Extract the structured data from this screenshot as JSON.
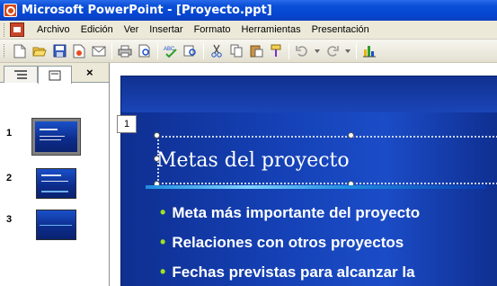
{
  "window": {
    "title": "Microsoft PowerPoint - [Proyecto.ppt]",
    "title_bar_color": "#0a4ed6"
  },
  "menu": {
    "items": [
      "Archivo",
      "Edición",
      "Ver",
      "Insertar",
      "Formato",
      "Herramientas",
      "Presentación"
    ]
  },
  "toolbar": {
    "buttons": [
      "new-icon",
      "open-icon",
      "save-icon",
      "permission-icon",
      "email-icon",
      "print-icon",
      "print-preview-icon",
      "spelling-icon",
      "research-icon",
      "cut-icon",
      "copy-icon",
      "paste-icon",
      "format-painter-icon",
      "undo-icon",
      "redo-icon",
      "chart-icon"
    ],
    "spelling_glyph": "ABC"
  },
  "left_pane": {
    "tabs": [
      "outline-tab",
      "slides-tab"
    ],
    "close_glyph": "×",
    "slides": [
      {
        "number": "1",
        "selected": true
      },
      {
        "number": "2",
        "selected": false
      },
      {
        "number": "3",
        "selected": false
      }
    ]
  },
  "slide": {
    "number": "1",
    "title": "Metas del proyecto",
    "bullets": [
      "Meta más importante del proyecto",
      "Relaciones con otros proyectos",
      "Fechas previstas para alcanzar la"
    ],
    "background_color": "#1440b4",
    "bullet_color": "#9fe11f",
    "accent_color": "#1e8be0"
  }
}
